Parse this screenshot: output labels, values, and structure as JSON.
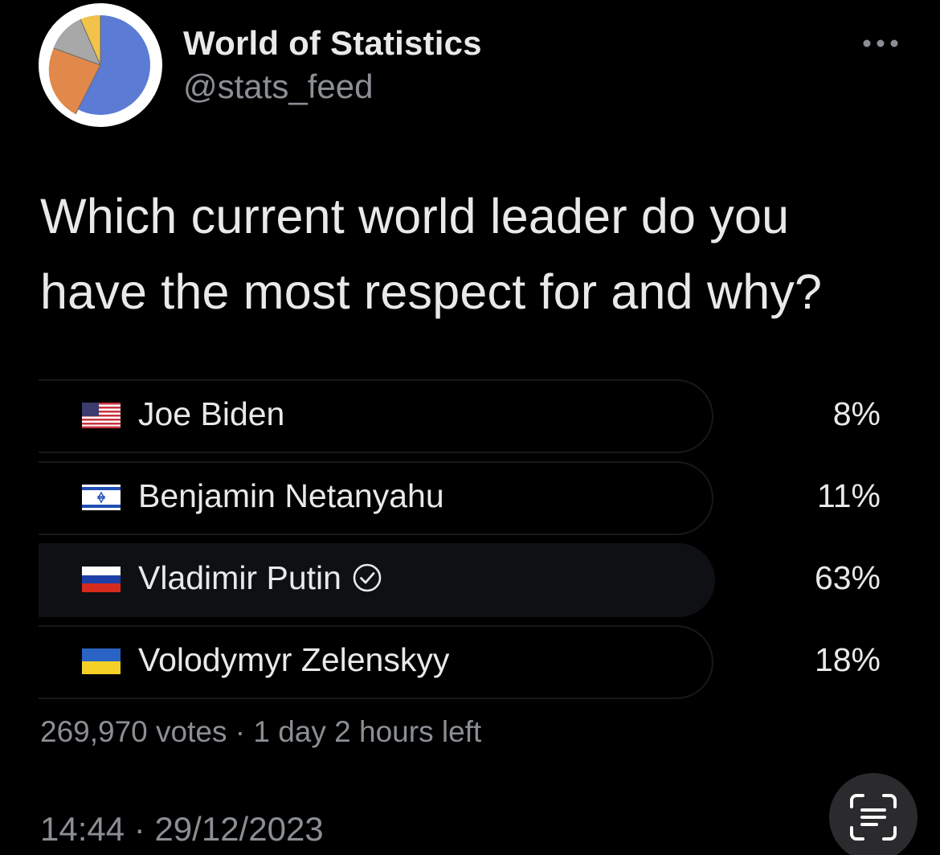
{
  "tweet": {
    "author": {
      "display_name": "World of Statistics",
      "handle": "@stats_feed",
      "avatar_icon": "pie-chart-icon",
      "avatar_colors": [
        "#5b7bd5",
        "#e0894a",
        "#a8a8a8",
        "#f1c34a"
      ]
    },
    "more_icon": "more-horizontal-icon",
    "question_line1": "Which current world leader do you",
    "question_line2": "have the most respect for and why?",
    "poll": {
      "options": [
        {
          "label": "Joe Biden",
          "percent": "8%",
          "fraction": 0.08,
          "flag_icon": "us-flag-icon",
          "winner": false
        },
        {
          "label": "Benjamin Netanyahu",
          "percent": "11%",
          "fraction": 0.11,
          "flag_icon": "israel-flag-icon",
          "winner": false
        },
        {
          "label": "Vladimir Putin",
          "percent": "63%",
          "fraction": 0.63,
          "flag_icon": "russia-flag-icon",
          "winner": true,
          "selected_icon": "check-circle-icon"
        },
        {
          "label": "Volodymyr Zelenskyy",
          "percent": "18%",
          "fraction": 0.18,
          "flag_icon": "ukraine-flag-icon",
          "winner": false
        }
      ],
      "votes": "269,970 votes",
      "separator": "·",
      "time_left": "1 day 2 hours left"
    },
    "time": "14:44",
    "date": "29/12/2023",
    "scan_icon": "text-scan-icon"
  }
}
